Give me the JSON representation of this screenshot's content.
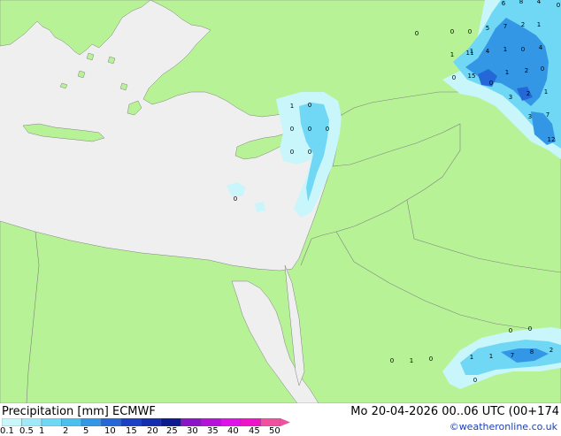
{
  "header": {
    "title": "Precipitation [mm]  ECMWF",
    "run": "Mo 20-04-2026 00..06 UTC (00+174",
    "credit": "©weatheronline.co.uk"
  },
  "legend": {
    "ticks": [
      "0.1",
      "0.5",
      "1",
      "2",
      "5",
      "10",
      "15",
      "20",
      "25",
      "30",
      "35",
      "40",
      "45",
      "50"
    ],
    "colors": [
      "#c8f6fa",
      "#9eeaf8",
      "#70d8f5",
      "#4cbfee",
      "#3497e6",
      "#2468d8",
      "#1c3fc4",
      "#142bad",
      "#0c1a8e",
      "#8c14c8",
      "#b414d8",
      "#dc14e6",
      "#f014c8",
      "#f050a0"
    ]
  },
  "map": {
    "colors": {
      "sea": "#efefef",
      "land": "#b7f396",
      "border": "#808080",
      "precip_light": "#c8f6fa",
      "precip_mid": "#70d8f5",
      "precip_heavy": "#3497e6",
      "precip_max": "#2468d8"
    },
    "point_values": [
      {
        "v": "1"
      },
      {
        "v": "0"
      },
      {
        "v": "0"
      },
      {
        "v": "0"
      },
      {
        "v": "0"
      },
      {
        "v": "0"
      },
      {
        "v": "0"
      },
      {
        "v": "0"
      },
      {
        "v": "0"
      },
      {
        "v": "0"
      },
      {
        "v": "0"
      },
      {
        "v": "1"
      },
      {
        "v": "5"
      },
      {
        "v": "7"
      },
      {
        "v": "2"
      },
      {
        "v": "1"
      },
      {
        "v": "6"
      },
      {
        "v": "8"
      },
      {
        "v": "4"
      },
      {
        "v": "0"
      },
      {
        "v": "1"
      },
      {
        "v": "11"
      },
      {
        "v": "4"
      },
      {
        "v": "1"
      },
      {
        "v": "0"
      },
      {
        "v": "4"
      },
      {
        "v": "0"
      },
      {
        "v": "15"
      },
      {
        "v": "0"
      },
      {
        "v": "1"
      },
      {
        "v": "2"
      },
      {
        "v": "0"
      },
      {
        "v": "3"
      },
      {
        "v": "2"
      },
      {
        "v": "1"
      },
      {
        "v": "3"
      },
      {
        "v": "7"
      },
      {
        "v": "12"
      },
      {
        "v": "0"
      },
      {
        "v": "1"
      },
      {
        "v": "0"
      },
      {
        "v": "0"
      },
      {
        "v": "0"
      },
      {
        "v": "1"
      },
      {
        "v": "1"
      },
      {
        "v": "7"
      },
      {
        "v": "8"
      },
      {
        "v": "2"
      },
      {
        "v": "0"
      }
    ]
  }
}
